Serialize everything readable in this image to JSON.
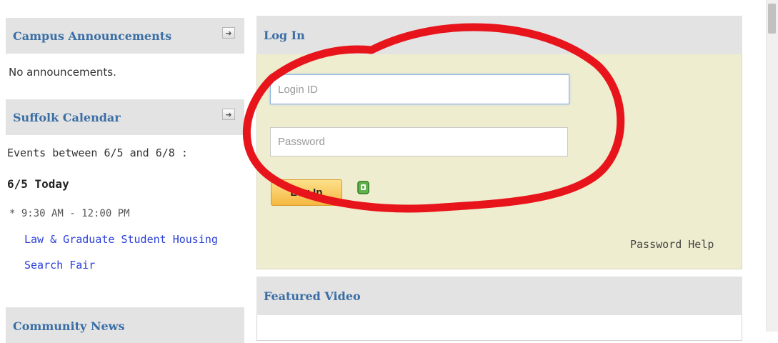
{
  "sidebar": {
    "announcements": {
      "title": "Campus Announcements",
      "body": "No announcements."
    },
    "calendar": {
      "title": "Suffolk Calendar",
      "range": "Events between 6/5 and 6/8 :",
      "day_heading": "6/5 Today",
      "event_time": "* 9:30 AM - 12:00 PM",
      "event_title_line1": "Law & Graduate Student Housing",
      "event_title_line2": "Search Fair"
    },
    "community": {
      "title": "Community News"
    },
    "expand_icon": "arrow-right-icon"
  },
  "login": {
    "title": "Log In",
    "login_placeholder": "Login ID",
    "password_placeholder": "Password",
    "button_label": "Log In",
    "lock_icon": "lock-icon",
    "password_help": "Password Help"
  },
  "featured": {
    "title": "Featured Video"
  },
  "colors": {
    "header_bg": "#e3e3e3",
    "header_text": "#3a6ea5",
    "login_panel_bg": "#efedcf",
    "link": "#2a3fd8",
    "annotation_red": "#e8141b"
  }
}
